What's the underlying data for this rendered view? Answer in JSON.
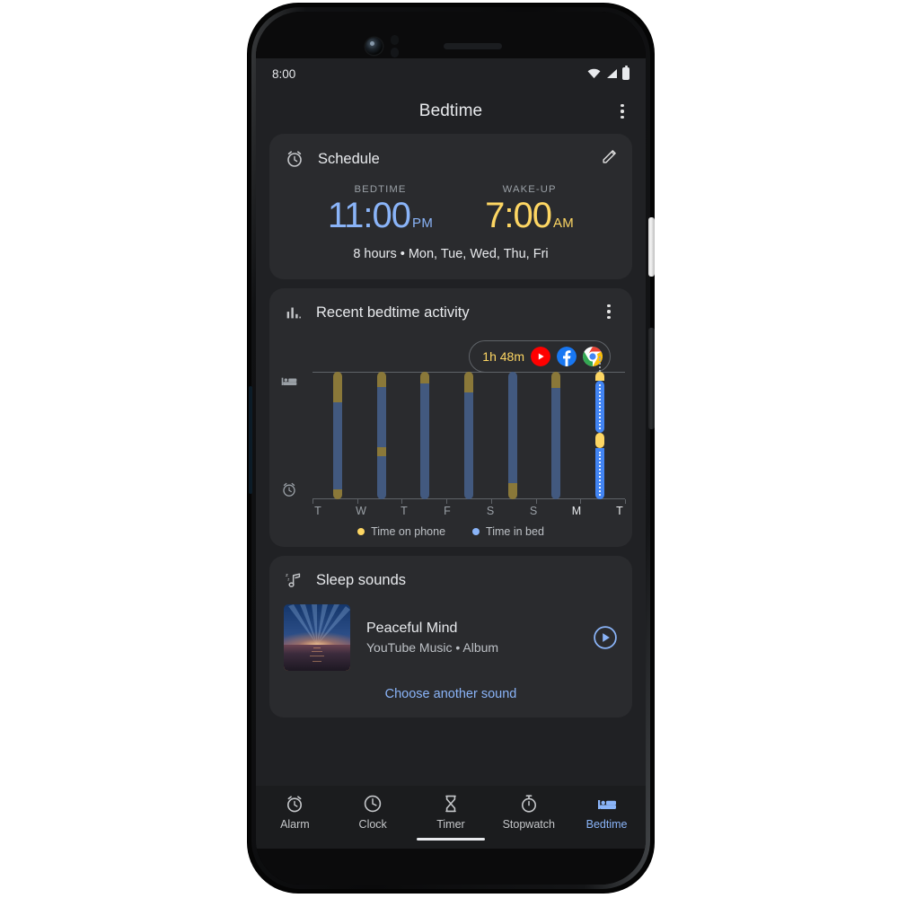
{
  "status_bar": {
    "time": "8:00",
    "icons": [
      "wifi-icon",
      "signal-icon",
      "battery-icon"
    ]
  },
  "app_bar": {
    "title": "Bedtime",
    "overflow_label": "More options"
  },
  "schedule_card": {
    "icon": "alarm-schedule-icon",
    "title": "Schedule",
    "edit_icon": "pencil-edit-icon",
    "bedtime": {
      "label": "BEDTIME",
      "time": "11:00",
      "meridiem": "PM",
      "color": "#8ab4f8"
    },
    "wakeup": {
      "label": "WAKE-UP",
      "time": "7:00",
      "meridiem": "AM",
      "color": "#fdd663"
    },
    "summary": "8 hours • Mon, Tue, Wed, Thu, Fri"
  },
  "activity_card": {
    "icon": "bar-chart-icon",
    "title": "Recent bedtime activity",
    "overflow_label": "More options",
    "tooltip": {
      "duration": "1h 48m",
      "apps": [
        "youtube-icon",
        "facebook-icon",
        "chrome-icon"
      ]
    },
    "axis_icons": {
      "top": "bed-icon",
      "bottom": "alarm-clock-icon"
    },
    "legend": [
      {
        "label": "Time on phone",
        "color": "#fdd663"
      },
      {
        "label": "Time in bed",
        "color": "#8ab4f8"
      }
    ]
  },
  "chart_data": {
    "type": "bar",
    "title": "Recent bedtime activity",
    "categories": [
      "T",
      "W",
      "T",
      "F",
      "S",
      "S",
      "M",
      "T"
    ],
    "highlighted_categories": [
      "M",
      "T"
    ],
    "selected_index": 6,
    "ylabel": "",
    "xlabel": "",
    "axis_top_icon": "bed-icon",
    "axis_bottom_icon": "alarm-clock-icon",
    "grid": false,
    "legend_position": "bottom",
    "series": [
      {
        "name": "Time on phone",
        "color": "#fdd663"
      },
      {
        "name": "Time in bed",
        "color": "#8ab4f8"
      }
    ],
    "bars": [
      {
        "day": "T",
        "x_pct": 8,
        "segments": [
          {
            "series": "Time on phone",
            "top_pct": 0,
            "height_pct": 24
          },
          {
            "series": "Time in bed",
            "top_pct": 24,
            "height_pct": 68
          },
          {
            "series": "Time on phone",
            "top_pct": 92,
            "height_pct": 8
          }
        ]
      },
      {
        "day": "W",
        "x_pct": 22,
        "segments": [
          {
            "series": "Time on phone",
            "top_pct": 0,
            "height_pct": 12
          },
          {
            "series": "Time in bed",
            "top_pct": 12,
            "height_pct": 47
          },
          {
            "series": "Time on phone",
            "top_pct": 59,
            "height_pct": 7
          },
          {
            "series": "Time in bed",
            "top_pct": 66,
            "height_pct": 34
          }
        ]
      },
      {
        "day": "T",
        "x_pct": 36,
        "segments": [
          {
            "series": "Time on phone",
            "top_pct": 0,
            "height_pct": 9
          },
          {
            "series": "Time in bed",
            "top_pct": 9,
            "height_pct": 91
          }
        ]
      },
      {
        "day": "F",
        "x_pct": 50,
        "segments": [
          {
            "series": "Time on phone",
            "top_pct": 0,
            "height_pct": 16
          },
          {
            "series": "Time in bed",
            "top_pct": 16,
            "height_pct": 84
          }
        ]
      },
      {
        "day": "S",
        "x_pct": 64,
        "segments": [
          {
            "series": "Time in bed",
            "top_pct": 0,
            "height_pct": 87
          },
          {
            "series": "Time on phone",
            "top_pct": 87,
            "height_pct": 13
          }
        ]
      },
      {
        "day": "S",
        "x_pct": 78,
        "segments": [
          {
            "series": "Time on phone",
            "top_pct": 0,
            "height_pct": 13
          },
          {
            "series": "Time in bed",
            "top_pct": 13,
            "height_pct": 87
          }
        ]
      },
      {
        "day": "M",
        "x_pct": 92,
        "selected": true,
        "segments": [
          {
            "series": "Time on phone",
            "top_pct": 0,
            "height_pct": 7
          },
          {
            "series": "Time in bed",
            "top_pct": 7,
            "height_pct": 41
          },
          {
            "series": "Time on phone",
            "top_pct": 48,
            "height_pct": 12
          },
          {
            "series": "Time in bed",
            "top_pct": 60,
            "height_pct": 40
          }
        ]
      }
    ]
  },
  "sleep_sounds_card": {
    "icon": "sleep-music-note-icon",
    "title": "Sleep  sounds",
    "track": {
      "artwork": "sunset-over-ocean-artwork",
      "title": "Peaceful Mind",
      "subtitle": "YouTube Music • Album",
      "play_icon": "play-circle-icon"
    },
    "choose_link": "Choose another sound"
  },
  "bottom_nav": {
    "items": [
      {
        "label": "Alarm",
        "icon": "alarm-icon",
        "active": false
      },
      {
        "label": "Clock",
        "icon": "clock-icon",
        "active": false
      },
      {
        "label": "Timer",
        "icon": "hourglass-timer-icon",
        "active": false
      },
      {
        "label": "Stopwatch",
        "icon": "stopwatch-icon",
        "active": false
      },
      {
        "label": "Bedtime",
        "icon": "bed-icon",
        "active": true
      }
    ],
    "active_color": "#8ab4f8"
  }
}
